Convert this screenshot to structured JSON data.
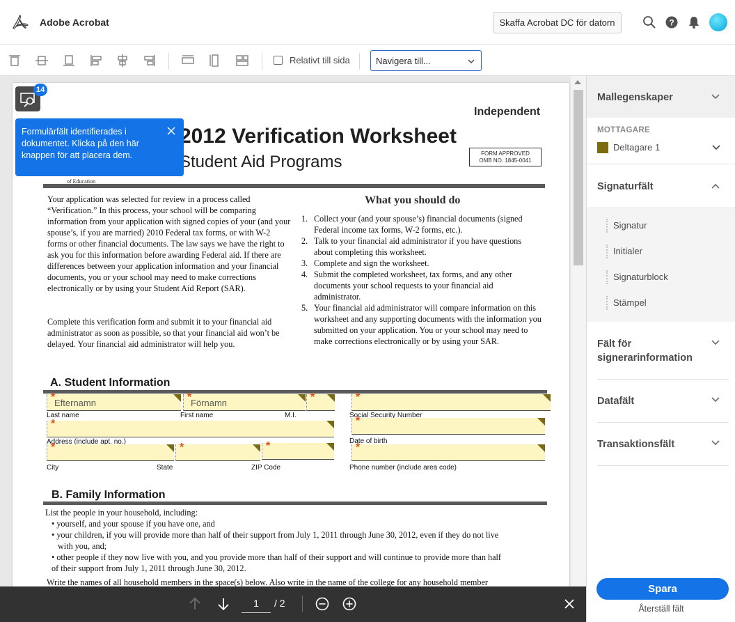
{
  "app": {
    "title": "Adobe Acrobat",
    "get_desktop_button": "Skaffa Acrobat DC för datorn"
  },
  "toolbar": {
    "relative_checkbox_label": "Relativt till sida",
    "navigate_select": "Navigera till..."
  },
  "tag_button": {
    "badge_count": "14"
  },
  "tooltip": {
    "text": "Formulärfält identifierades i dokumentet. Klicka på den här knappen för att placera dem."
  },
  "document": {
    "independent": "Independent",
    "title": "2012 Verification Worksheet",
    "subtitle": "Student Aid Programs",
    "form_approved_line1": "FORM APPROVED",
    "form_approved_line2": "OMB NO. 1845-0041",
    "dept_fragment": "of Education",
    "intro_para1": "Your application was selected for review in a process called “Verification.” In this process, your school will be comparing information from your application with signed copies of your (and your spouse’s, if you are married) 2010 Federal tax forms, or with W-2 forms or other financial documents. The law says we have the right to ask you for this information before awarding Federal aid. If there are differences between your application information and your financial documents, you or your school may need to make corrections electronically or by using your Student Aid Report (SAR).",
    "intro_para2": "Complete this verification form and submit it to your financial aid administrator as soon as possible, so that your financial aid won’t be delayed. Your financial aid administrator will help you.",
    "what_to_do_heading": "What you should do",
    "steps": [
      {
        "n": "1.",
        "text": "Collect your (and your spouse’s) financial documents (signed Federal income tax forms, W-2 forms, etc.)."
      },
      {
        "n": "2.",
        "text": "Talk to your financial aid administrator if you have questions about completing this worksheet."
      },
      {
        "n": "3.",
        "text": "Complete and sign the worksheet."
      },
      {
        "n": "4.",
        "text": "Submit the completed worksheet, tax forms, and any other documents your school requests to your financial aid administrator."
      },
      {
        "n": "5.",
        "text": "Your financial aid administrator will compare information on this worksheet and any supporting documents with the information you submitted on your application. You or your school may need to make corrections electronically or by using your SAR."
      }
    ],
    "section_a": "A. Student Information",
    "field_last_name_placeholder": "Efternamn",
    "field_first_name_placeholder": "Förnamn",
    "label_last_name": "Last name",
    "label_first_name": "First name",
    "label_mi": "M.I.",
    "label_ssn": "Social Security Number",
    "label_address": "Address (include apt. no.)",
    "label_dob": "Date of birth",
    "label_city": "City",
    "label_state": "State",
    "label_zip": "ZIP Code",
    "label_phone": "Phone number (include area code)",
    "section_b": "B. Family Information",
    "family_intro": "List the people in your household, including:",
    "bullet1": "• yourself, and your spouse if you have one, and",
    "bullet2a": "• your children, if you will provide more than half of their support from July 1, 2011 through June 30, 2012, even if they do not live",
    "bullet2b": "with you, and;",
    "bullet3a": "• other people if they now live with you, and you provide more than half of their support and will continue to provide more than half",
    "bullet3b": "of their support from July 1, 2011 through June 30, 2012.",
    "write_names": "Write the names of all household members in the space(s) below. Also write in the name of the college for any household member"
  },
  "pager": {
    "current_page": "1",
    "total_pages": "/ 2"
  },
  "right_panel": {
    "template_properties": "Mallegenskaper",
    "recipients_label": "MOTTAGARE",
    "recipient_name": "Deltagare 1",
    "recipient_color": "#7d6b0f",
    "signature_fields": "Signaturfält",
    "signature_items": [
      "Signatur",
      "Initialer",
      "Signaturblock",
      "Stämpel"
    ],
    "signer_info_fields_line1": "Fält för",
    "signer_info_fields_line2": "signerarinformation",
    "data_fields": "Datafält",
    "transaction_fields": "Transaktionsfält",
    "save_button": "Spara",
    "reset_fields": "Återställ fält"
  },
  "colors": {
    "accent": "#1473e6",
    "field_fill": "#fdf6c3",
    "required_star": "#e0501a"
  }
}
